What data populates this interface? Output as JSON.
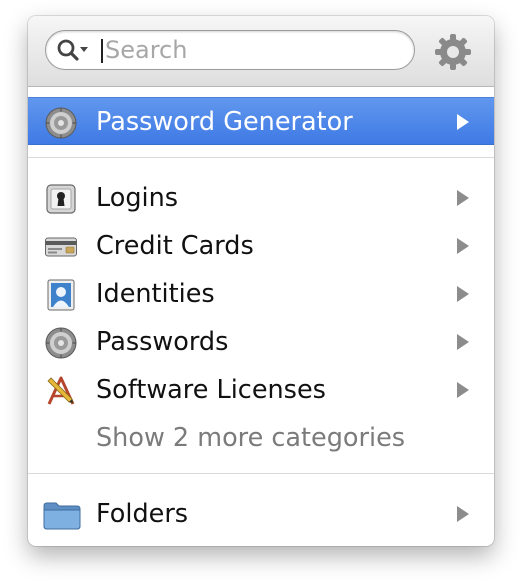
{
  "search": {
    "placeholder": "Search"
  },
  "generator": {
    "label": "Password Generator",
    "icon": "dial-lock-icon"
  },
  "categories": [
    {
      "label": "Logins",
      "icon": "keyhole-icon"
    },
    {
      "label": "Credit Cards",
      "icon": "credit-card-icon"
    },
    {
      "label": "Identities",
      "icon": "identity-card-icon"
    },
    {
      "label": "Passwords",
      "icon": "dial-lock-icon"
    },
    {
      "label": "Software Licenses",
      "icon": "ruler-pencil-icon"
    }
  ],
  "more_categories": "Show 2 more categories",
  "folders": {
    "label": "Folders",
    "icon": "folder-icon"
  },
  "colors": {
    "highlight": "#4a85e8",
    "text": "#111111",
    "muted": "#7b7b7b"
  }
}
